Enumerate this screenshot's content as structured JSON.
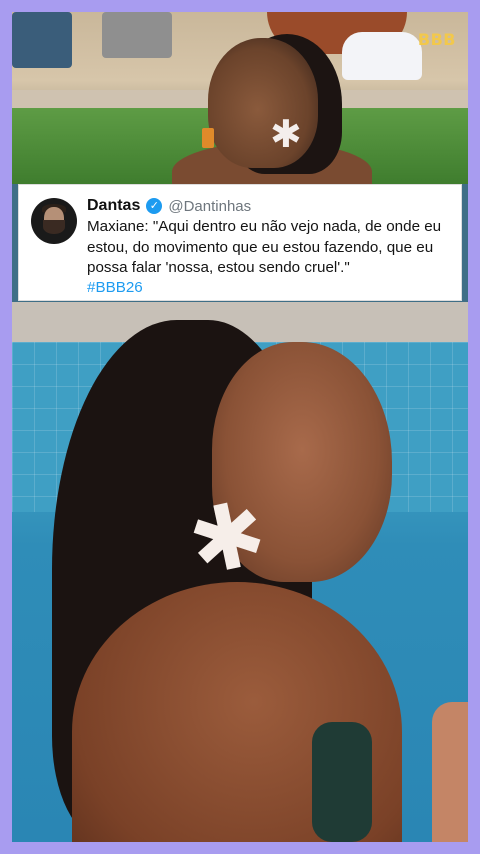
{
  "overlay": {
    "logo": "BBB"
  },
  "tweet": {
    "display_name": "Dantas",
    "handle": "@Dantinhas",
    "verified_icon": "verified-badge-icon",
    "text": "Maxiane: \"Aqui dentro eu não vejo nada, de onde eu estou, do movimento que eu estou fazendo, que eu possa falar 'nossa, estou sendo cruel'.\"",
    "hashtag": "#BBB26"
  },
  "colors": {
    "frame_border": "#a89cf0",
    "link": "#1d9bf0",
    "logo": "#f2c84b"
  }
}
